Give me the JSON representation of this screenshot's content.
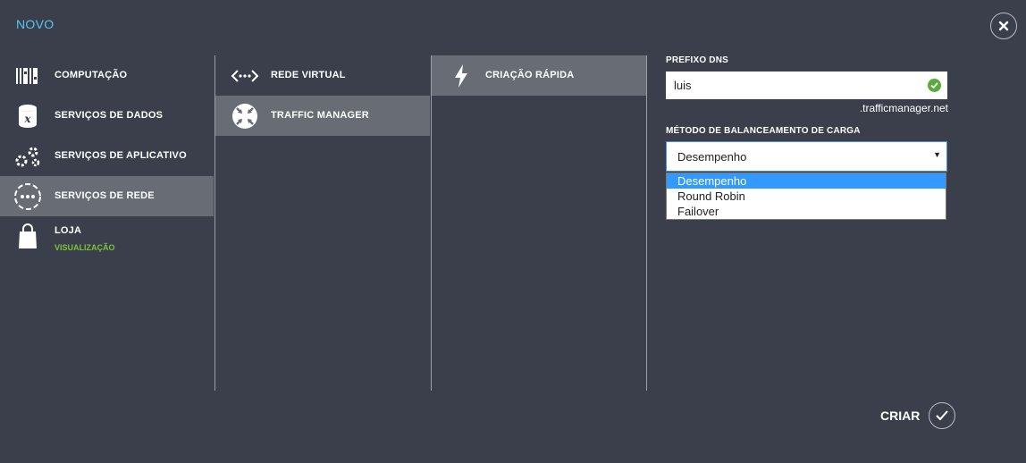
{
  "header": {
    "title": "NOVO",
    "close_icon": "close-icon"
  },
  "categories": [
    {
      "label": "COMPUTAÇÃO",
      "icon": "compute-icon",
      "sub": ""
    },
    {
      "label": "SERVIÇOS DE DADOS",
      "icon": "database-icon",
      "sub": ""
    },
    {
      "label": "SERVIÇOS DE APLICATIVO",
      "icon": "gears-icon",
      "sub": ""
    },
    {
      "label": "SERVIÇOS DE REDE",
      "icon": "network-icon",
      "sub": ""
    },
    {
      "label": "LOJA",
      "icon": "shopping-bag-icon",
      "sub": "VISUALIZAÇÃO"
    }
  ],
  "network_services": [
    {
      "label": "REDE VIRTUAL",
      "icon": "virtual-network-icon"
    },
    {
      "label": "TRAFFIC MANAGER",
      "icon": "traffic-manager-icon"
    }
  ],
  "create_options": [
    {
      "label": "CRIAÇÃO RÁPIDA",
      "icon": "lightning-icon"
    }
  ],
  "form": {
    "dns_prefix_label": "PREFIXO DNS",
    "dns_prefix_value": "luis",
    "dns_suffix": ".trafficmanager.net",
    "lb_method_label": "MÉTODO DE BALANCEAMENTO DE CARGA",
    "lb_method_selected": "Desempenho",
    "lb_method_options": [
      "Desempenho",
      "Round Robin",
      "Failover"
    ]
  },
  "footer": {
    "create_label": "CRIAR"
  },
  "colors": {
    "accent": "#54c7f2",
    "background": "#3a3f4b",
    "selected": "#676c75",
    "success": "#5aab3c",
    "preview": "#7ec13b",
    "highlight": "#3399ff"
  }
}
